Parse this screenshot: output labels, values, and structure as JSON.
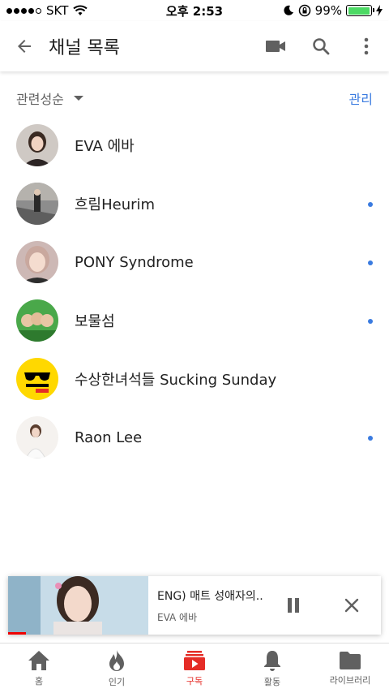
{
  "status_bar": {
    "carrier": "SKT",
    "time": "오후 2:53",
    "battery": "99%",
    "battery_level": 0.99
  },
  "app_bar": {
    "title": "채널 목록"
  },
  "sort": {
    "label": "관련성순",
    "manage": "관리"
  },
  "channels": [
    {
      "name": "EVA 에바",
      "has_new": false
    },
    {
      "name": "흐림Heurim",
      "has_new": true
    },
    {
      "name": "PONY Syndrome",
      "has_new": true
    },
    {
      "name": "보물섬",
      "has_new": true
    },
    {
      "name": "수상한녀석들 Sucking Sunday",
      "has_new": false
    },
    {
      "name": "Raon Lee",
      "has_new": true
    }
  ],
  "mini_player": {
    "title": "ENG) 매트 성애자의...",
    "channel": "EVA 에바",
    "progress": 0.13
  },
  "bottom_nav": [
    {
      "label": "홈",
      "icon": "home-icon"
    },
    {
      "label": "인기",
      "icon": "flame-icon"
    },
    {
      "label": "구독",
      "icon": "subscriptions-icon",
      "active": true
    },
    {
      "label": "활동",
      "icon": "bell-icon"
    },
    {
      "label": "라이브러리",
      "icon": "folder-icon"
    }
  ],
  "colors": {
    "accent_blue": "#3a7be0",
    "brand_red": "#e52d27"
  }
}
